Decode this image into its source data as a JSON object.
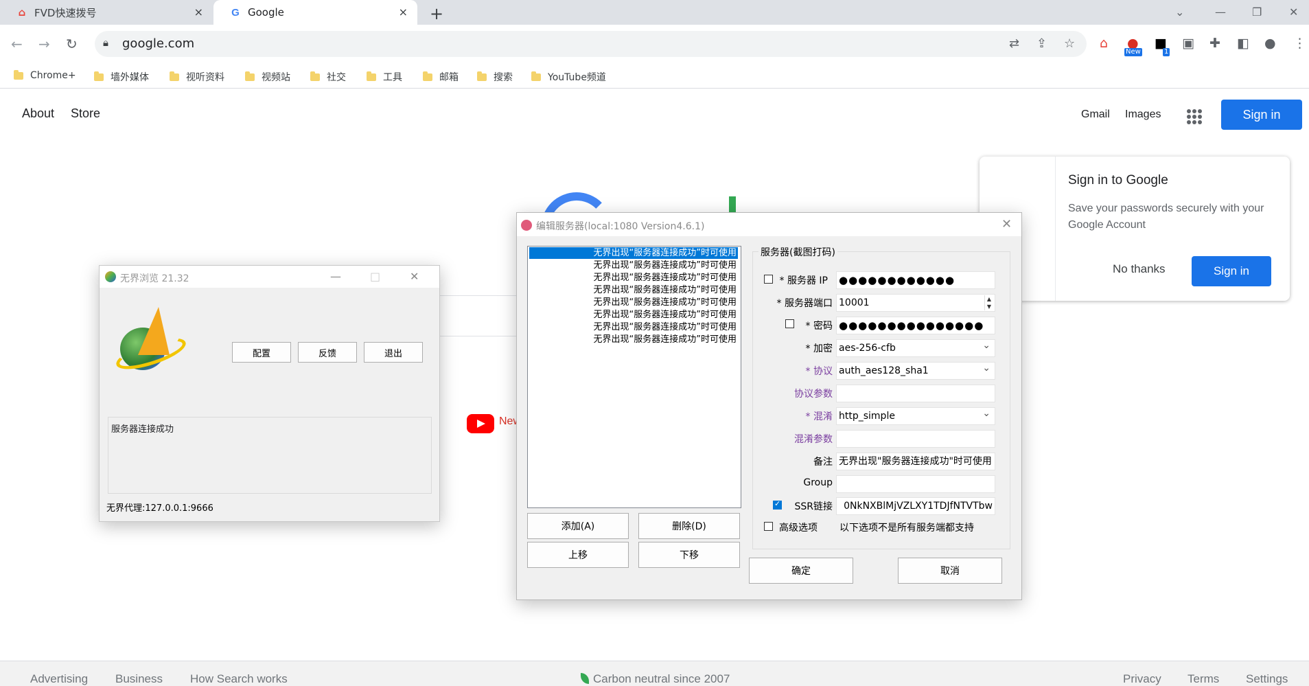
{
  "browser": {
    "tabs": [
      {
        "title": "FVD快速拨号",
        "close": "×"
      },
      {
        "title": "Google",
        "close": "×"
      }
    ],
    "new_tab": "+",
    "window_controls": [
      "⌄",
      "—",
      "❐",
      "✕"
    ],
    "url": "google.com",
    "extension_badges": {
      "new": "New",
      "count": "1"
    },
    "bookmarks": [
      "Chrome+",
      "墙外媒体",
      "视听资料",
      "视频站",
      "社交",
      "工具",
      "邮箱",
      "搜索",
      "YouTube频道"
    ]
  },
  "google": {
    "top_left": {
      "about": "About",
      "store": "Store"
    },
    "top_right": {
      "gmail": "Gmail",
      "images": "Images",
      "sign_in": "Sign in"
    },
    "popup": {
      "title": "Sign in to Google",
      "text": "Save your passwords securely with your Google Account",
      "no_thanks": "No thanks",
      "sign_in": "Sign in"
    },
    "yt_text": "New",
    "footer": {
      "advertising": "Advertising",
      "business": "Business",
      "how_search_works": "How Search works",
      "carbon": "Carbon neutral since 2007",
      "privacy": "Privacy",
      "terms": "Terms",
      "settings": "Settings"
    }
  },
  "wujie": {
    "title": "无界浏览 21.32",
    "buttons": {
      "config": "配置",
      "feedback": "反馈",
      "exit": "退出"
    },
    "log": "服务器连接成功",
    "status": "无界代理:127.0.0.1:9666",
    "window_controls": [
      "—",
      "□",
      "✕"
    ]
  },
  "dialog": {
    "title": "编辑服务器(local:1080 Version4.6.1)",
    "close": "✕",
    "list_items": [
      "无界出现“服务器连接成功”时可使用",
      "无界出现“服务器连接成功”时可使用",
      "无界出现“服务器连接成功”时可使用",
      "无界出现“服务器连接成功”时可使用",
      "无界出现“服务器连接成功”时可使用",
      "无界出现“服务器连接成功”时可使用",
      "无界出现“服务器连接成功”时可使用",
      "无界出现“服务器连接成功”时可使用"
    ],
    "buttons": {
      "add": "添加(A)",
      "delete": "删除(D)",
      "up": "上移",
      "down": "下移",
      "ok": "确定",
      "cancel": "取消"
    },
    "group_title": "服务器(截图打码)",
    "labels": {
      "server_ip": "* 服务器 IP",
      "server_port": "* 服务器端口",
      "password": "* 密码",
      "encryption": "* 加密",
      "protocol": "* 协议",
      "protocol_param": "协议参数",
      "obfs": "* 混淆",
      "obfs_param": "混淆参数",
      "remarks": "备注",
      "group": "Group",
      "ssr_link": "SSR链接",
      "advanced": "高级选项"
    },
    "values": {
      "server_ip": "●●●●●●●●●●●●",
      "server_port": "10001",
      "password": "●●●●●●●●●●●●●●●",
      "encryption": "aes-256-cfb",
      "protocol": "auth_aes128_sha1",
      "protocol_param": "",
      "obfs": "http_simple",
      "obfs_param": "",
      "remarks": "无界出现\"服务器连接成功\"时可使用",
      "group": "",
      "ssr_link": "0NkNXBlMjVZLXY1TDJfNTVTbw",
      "advanced_note": "以下选项不是所有服务端都支持"
    },
    "spin": {
      "up": "▲",
      "down": "▼"
    },
    "checkboxes": {
      "server_ip": false,
      "password": false,
      "ssr_link": true,
      "advanced": false
    }
  }
}
